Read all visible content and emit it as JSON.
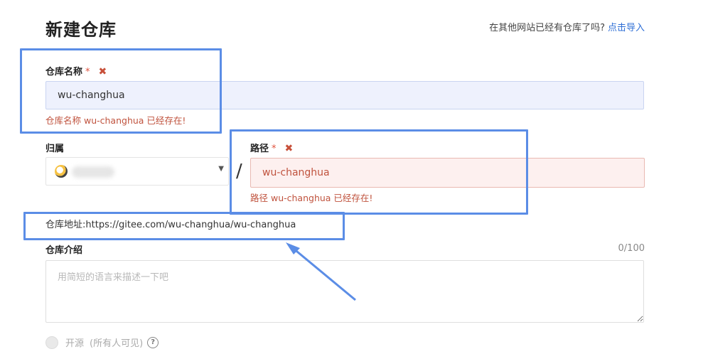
{
  "header": {
    "title": "新建仓库",
    "import_prompt": "在其他网站已经有仓库了吗?",
    "import_link": "点击导入"
  },
  "repo_name": {
    "label": "仓库名称",
    "required_mark": "*",
    "error_icon": "close-icon",
    "value": "wu-changhua",
    "error": "仓库名称 wu-changhua 已经存在!"
  },
  "owner": {
    "label": "归属",
    "avatar_icon": "avatar-icon"
  },
  "path": {
    "separator": "/",
    "label": "路径",
    "required_mark": "*",
    "value": "wu-changhua",
    "error": "路径 wu-changhua 已经存在!"
  },
  "address": {
    "label": "仓库地址:",
    "url": "https://gitee.com/wu-changhua/wu-changhua"
  },
  "description": {
    "label": "仓库介绍",
    "counter": "0/100",
    "placeholder": "用简短的语言来描述一下吧"
  },
  "visibility": {
    "option_label": "开源",
    "option_hint": "(所有人可见)"
  },
  "colors": {
    "accent_link": "#2f6fd6",
    "error": "#c0533e",
    "annotation": "#5b8de6"
  }
}
